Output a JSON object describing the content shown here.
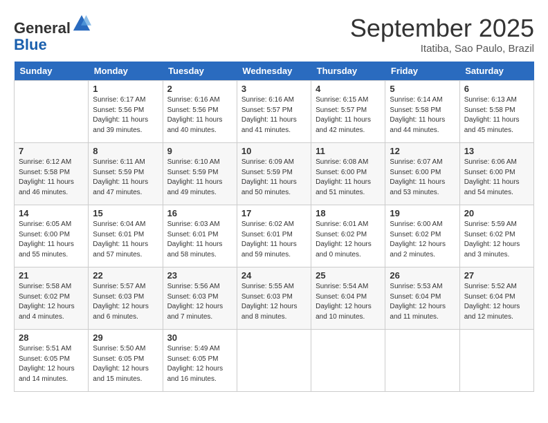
{
  "header": {
    "logo_general": "General",
    "logo_blue": "Blue",
    "month_title": "September 2025",
    "location": "Itatiba, Sao Paulo, Brazil"
  },
  "days_of_week": [
    "Sunday",
    "Monday",
    "Tuesday",
    "Wednesday",
    "Thursday",
    "Friday",
    "Saturday"
  ],
  "weeks": [
    [
      {
        "day": "",
        "sunrise": "",
        "sunset": "",
        "daylight": ""
      },
      {
        "day": "1",
        "sunrise": "Sunrise: 6:17 AM",
        "sunset": "Sunset: 5:56 PM",
        "daylight": "Daylight: 11 hours and 39 minutes."
      },
      {
        "day": "2",
        "sunrise": "Sunrise: 6:16 AM",
        "sunset": "Sunset: 5:56 PM",
        "daylight": "Daylight: 11 hours and 40 minutes."
      },
      {
        "day": "3",
        "sunrise": "Sunrise: 6:16 AM",
        "sunset": "Sunset: 5:57 PM",
        "daylight": "Daylight: 11 hours and 41 minutes."
      },
      {
        "day": "4",
        "sunrise": "Sunrise: 6:15 AM",
        "sunset": "Sunset: 5:57 PM",
        "daylight": "Daylight: 11 hours and 42 minutes."
      },
      {
        "day": "5",
        "sunrise": "Sunrise: 6:14 AM",
        "sunset": "Sunset: 5:58 PM",
        "daylight": "Daylight: 11 hours and 44 minutes."
      },
      {
        "day": "6",
        "sunrise": "Sunrise: 6:13 AM",
        "sunset": "Sunset: 5:58 PM",
        "daylight": "Daylight: 11 hours and 45 minutes."
      }
    ],
    [
      {
        "day": "7",
        "sunrise": "Sunrise: 6:12 AM",
        "sunset": "Sunset: 5:58 PM",
        "daylight": "Daylight: 11 hours and 46 minutes."
      },
      {
        "day": "8",
        "sunrise": "Sunrise: 6:11 AM",
        "sunset": "Sunset: 5:59 PM",
        "daylight": "Daylight: 11 hours and 47 minutes."
      },
      {
        "day": "9",
        "sunrise": "Sunrise: 6:10 AM",
        "sunset": "Sunset: 5:59 PM",
        "daylight": "Daylight: 11 hours and 49 minutes."
      },
      {
        "day": "10",
        "sunrise": "Sunrise: 6:09 AM",
        "sunset": "Sunset: 5:59 PM",
        "daylight": "Daylight: 11 hours and 50 minutes."
      },
      {
        "day": "11",
        "sunrise": "Sunrise: 6:08 AM",
        "sunset": "Sunset: 6:00 PM",
        "daylight": "Daylight: 11 hours and 51 minutes."
      },
      {
        "day": "12",
        "sunrise": "Sunrise: 6:07 AM",
        "sunset": "Sunset: 6:00 PM",
        "daylight": "Daylight: 11 hours and 53 minutes."
      },
      {
        "day": "13",
        "sunrise": "Sunrise: 6:06 AM",
        "sunset": "Sunset: 6:00 PM",
        "daylight": "Daylight: 11 hours and 54 minutes."
      }
    ],
    [
      {
        "day": "14",
        "sunrise": "Sunrise: 6:05 AM",
        "sunset": "Sunset: 6:00 PM",
        "daylight": "Daylight: 11 hours and 55 minutes."
      },
      {
        "day": "15",
        "sunrise": "Sunrise: 6:04 AM",
        "sunset": "Sunset: 6:01 PM",
        "daylight": "Daylight: 11 hours and 57 minutes."
      },
      {
        "day": "16",
        "sunrise": "Sunrise: 6:03 AM",
        "sunset": "Sunset: 6:01 PM",
        "daylight": "Daylight: 11 hours and 58 minutes."
      },
      {
        "day": "17",
        "sunrise": "Sunrise: 6:02 AM",
        "sunset": "Sunset: 6:01 PM",
        "daylight": "Daylight: 11 hours and 59 minutes."
      },
      {
        "day": "18",
        "sunrise": "Sunrise: 6:01 AM",
        "sunset": "Sunset: 6:02 PM",
        "daylight": "Daylight: 12 hours and 0 minutes."
      },
      {
        "day": "19",
        "sunrise": "Sunrise: 6:00 AM",
        "sunset": "Sunset: 6:02 PM",
        "daylight": "Daylight: 12 hours and 2 minutes."
      },
      {
        "day": "20",
        "sunrise": "Sunrise: 5:59 AM",
        "sunset": "Sunset: 6:02 PM",
        "daylight": "Daylight: 12 hours and 3 minutes."
      }
    ],
    [
      {
        "day": "21",
        "sunrise": "Sunrise: 5:58 AM",
        "sunset": "Sunset: 6:02 PM",
        "daylight": "Daylight: 12 hours and 4 minutes."
      },
      {
        "day": "22",
        "sunrise": "Sunrise: 5:57 AM",
        "sunset": "Sunset: 6:03 PM",
        "daylight": "Daylight: 12 hours and 6 minutes."
      },
      {
        "day": "23",
        "sunrise": "Sunrise: 5:56 AM",
        "sunset": "Sunset: 6:03 PM",
        "daylight": "Daylight: 12 hours and 7 minutes."
      },
      {
        "day": "24",
        "sunrise": "Sunrise: 5:55 AM",
        "sunset": "Sunset: 6:03 PM",
        "daylight": "Daylight: 12 hours and 8 minutes."
      },
      {
        "day": "25",
        "sunrise": "Sunrise: 5:54 AM",
        "sunset": "Sunset: 6:04 PM",
        "daylight": "Daylight: 12 hours and 10 minutes."
      },
      {
        "day": "26",
        "sunrise": "Sunrise: 5:53 AM",
        "sunset": "Sunset: 6:04 PM",
        "daylight": "Daylight: 12 hours and 11 minutes."
      },
      {
        "day": "27",
        "sunrise": "Sunrise: 5:52 AM",
        "sunset": "Sunset: 6:04 PM",
        "daylight": "Daylight: 12 hours and 12 minutes."
      }
    ],
    [
      {
        "day": "28",
        "sunrise": "Sunrise: 5:51 AM",
        "sunset": "Sunset: 6:05 PM",
        "daylight": "Daylight: 12 hours and 14 minutes."
      },
      {
        "day": "29",
        "sunrise": "Sunrise: 5:50 AM",
        "sunset": "Sunset: 6:05 PM",
        "daylight": "Daylight: 12 hours and 15 minutes."
      },
      {
        "day": "30",
        "sunrise": "Sunrise: 5:49 AM",
        "sunset": "Sunset: 6:05 PM",
        "daylight": "Daylight: 12 hours and 16 minutes."
      },
      {
        "day": "",
        "sunrise": "",
        "sunset": "",
        "daylight": ""
      },
      {
        "day": "",
        "sunrise": "",
        "sunset": "",
        "daylight": ""
      },
      {
        "day": "",
        "sunrise": "",
        "sunset": "",
        "daylight": ""
      },
      {
        "day": "",
        "sunrise": "",
        "sunset": "",
        "daylight": ""
      }
    ]
  ]
}
